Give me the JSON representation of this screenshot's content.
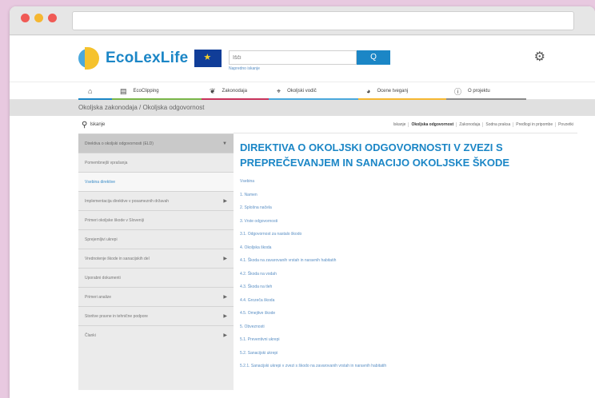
{
  "brand": {
    "name": "EcoLexLife"
  },
  "search": {
    "placeholder": "Išči",
    "button_label": "Q",
    "hint": "Napredno iskanje"
  },
  "nav": {
    "items": [
      {
        "label": "",
        "icon": "home-icon",
        "glyph": "⌂",
        "color": "#1b86c6"
      },
      {
        "label": "EcoClipping",
        "icon": "newspaper-icon",
        "glyph": "▤",
        "color": "#7ab648"
      },
      {
        "label": "Zakonodaja",
        "icon": "leaf-icon",
        "glyph": "❦",
        "color": "#c8335c"
      },
      {
        "label": "Okoljski vodič",
        "icon": "location-icon",
        "glyph": "⌖",
        "color": "#4aa8dc"
      },
      {
        "label": "Ocene tveganj",
        "icon": "globe-icon",
        "glyph": "◕",
        "color": "#f5b731"
      },
      {
        "label": "O projektu",
        "icon": "info-icon",
        "glyph": "ⓘ",
        "color": "#8a8a8a"
      }
    ]
  },
  "breadcrumb": "Okoljska zakonodaja / Okoljska odgovornost",
  "sidebar": {
    "search_label": "Iskanje",
    "items": [
      {
        "label": "Direktiva o okoljski odgovornosti (ELD)",
        "has_arrow": true,
        "state": "head"
      },
      {
        "label": "Pomembnejši vprašanja",
        "has_arrow": false,
        "state": ""
      },
      {
        "label": "Vsebina direktive",
        "has_arrow": false,
        "state": "active"
      },
      {
        "label": "Implementacija direktive v posameznih državah",
        "has_arrow": true,
        "state": ""
      },
      {
        "label": "Primeri okoljske škode v Sloveniji",
        "has_arrow": false,
        "state": ""
      },
      {
        "label": "Sprejemljivi ukrepi",
        "has_arrow": false,
        "state": ""
      },
      {
        "label": "Vrednotenje škode in sanacijskih del",
        "has_arrow": true,
        "state": ""
      },
      {
        "label": "Uporabni dokumenti",
        "has_arrow": false,
        "state": ""
      },
      {
        "label": "Primeri analize",
        "has_arrow": true,
        "state": ""
      },
      {
        "label": "Storitve pravne in tehnične podpore",
        "has_arrow": true,
        "state": ""
      },
      {
        "label": "Članki",
        "has_arrow": true,
        "state": ""
      }
    ]
  },
  "tabs": [
    {
      "label": "Iskanje",
      "active": false
    },
    {
      "label": "Okoljska odgovornost",
      "active": true
    },
    {
      "label": "Zakonodaja",
      "active": false
    },
    {
      "label": "Sodna praksa",
      "active": false
    },
    {
      "label": "Predlogi in pripombe",
      "active": false
    },
    {
      "label": "Povzetki",
      "active": false
    }
  ],
  "title": "DIREKTIVA O OKOLJSKI ODGOVORNOSTI V ZVEZI S PREPREČEVANJEM IN SANACIJO OKOLJSKE ŠKODE",
  "toc": [
    "Vsebina",
    "1. Namen",
    "2. Splošna načela",
    "3. Vrste odgovornosti",
    "3.1. Odgovornost za nastalo škodo",
    "4. Okoljska škoda",
    "4.1. Škoda na zavarovanih vrstah in naravnih habitatih",
    "4.2. Škoda na vodah",
    "4.3. Škoda na tleh",
    "4.4. Grozeča škoda",
    "4.5. Omejitve škode",
    "5. Obveznosti",
    "5.1. Preventivni ukrepi",
    "5.2. Sanacijski ukrepi",
    "5.2.1. Sanacijski ukrepi v zvezi s škodo na zavarovanih vrstah in naravnih habitatih"
  ]
}
